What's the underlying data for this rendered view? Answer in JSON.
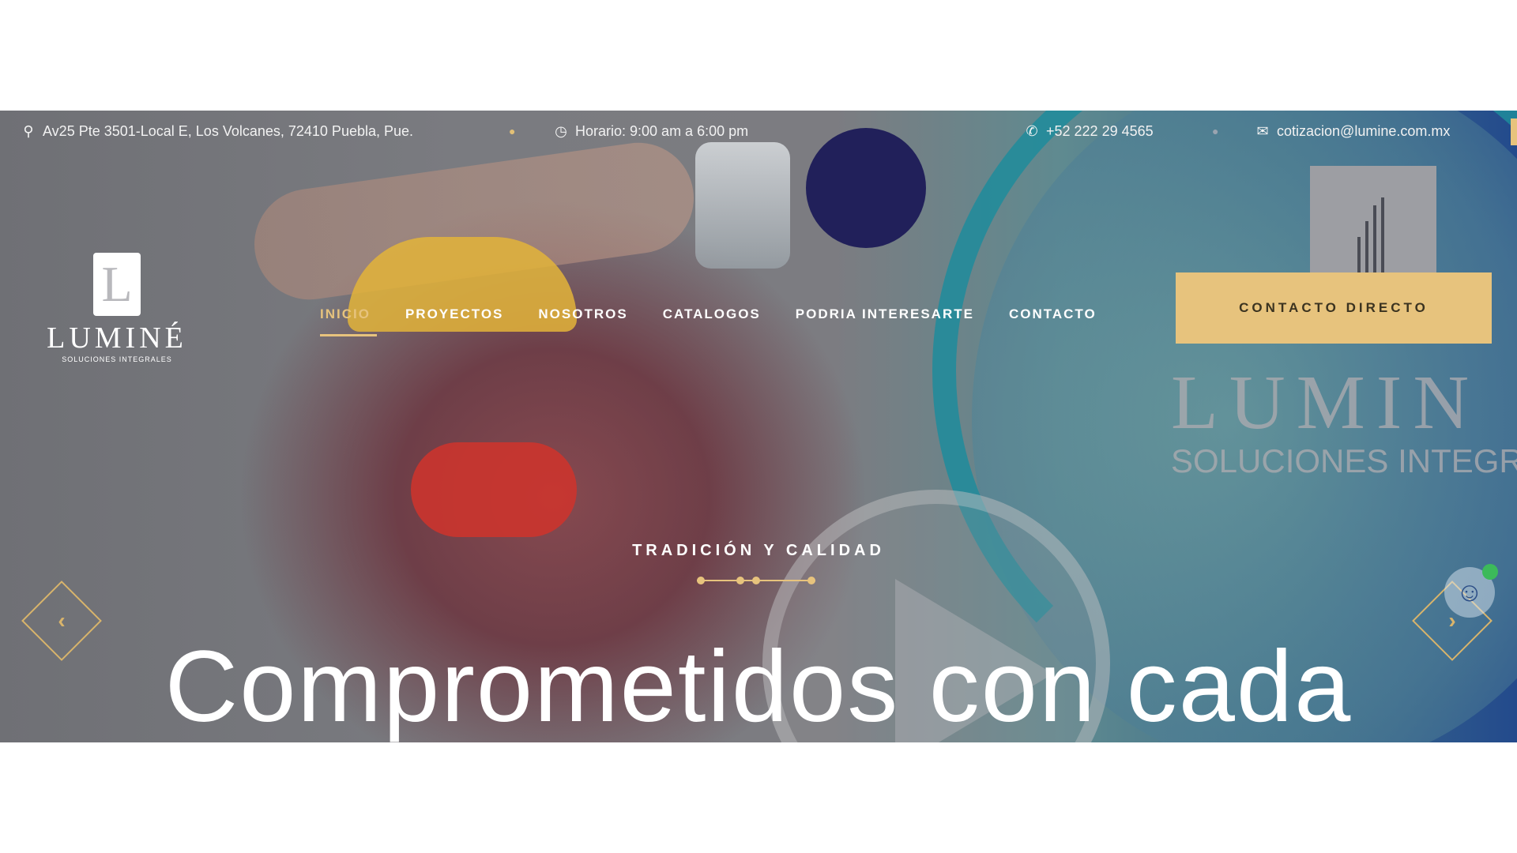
{
  "topbar": {
    "address": "Av25 Pte 3501-Local E, Los Volcanes, 72410 Puebla, Pue.",
    "hours": "Horario: 9:00 am a 6:00 pm",
    "phone": "+52 222 29 4565",
    "email": "cotizacion@lumine.com.mx",
    "icons": {
      "address": "map-pin-icon",
      "hours": "clock-icon",
      "phone": "phone-icon",
      "email": "envelope-icon"
    }
  },
  "brand": {
    "name": "LUMINÉ",
    "sub": "SOLUCIONES INTEGRALES",
    "background_text_1": "LUMIN",
    "background_text_2": "SOLUCIONES INTEGRA"
  },
  "nav": {
    "items": [
      {
        "label": "INICIO",
        "active": true
      },
      {
        "label": "PROYECTOS"
      },
      {
        "label": "NOSOTROS"
      },
      {
        "label": "CATALOGOS"
      },
      {
        "label": "PODRIA INTERESARTE"
      },
      {
        "label": "CONTACTO"
      }
    ],
    "cta": "CONTACTO DIRECTO"
  },
  "slide": {
    "tagline": "TRADICIÓN Y CALIDAD",
    "headline": "Comprometidos con cada"
  },
  "arrows": {
    "prev": "‹",
    "next": "›"
  },
  "colors": {
    "accent": "#e7c37d",
    "navy": "#21205a",
    "teal": "#1f8c9c"
  }
}
